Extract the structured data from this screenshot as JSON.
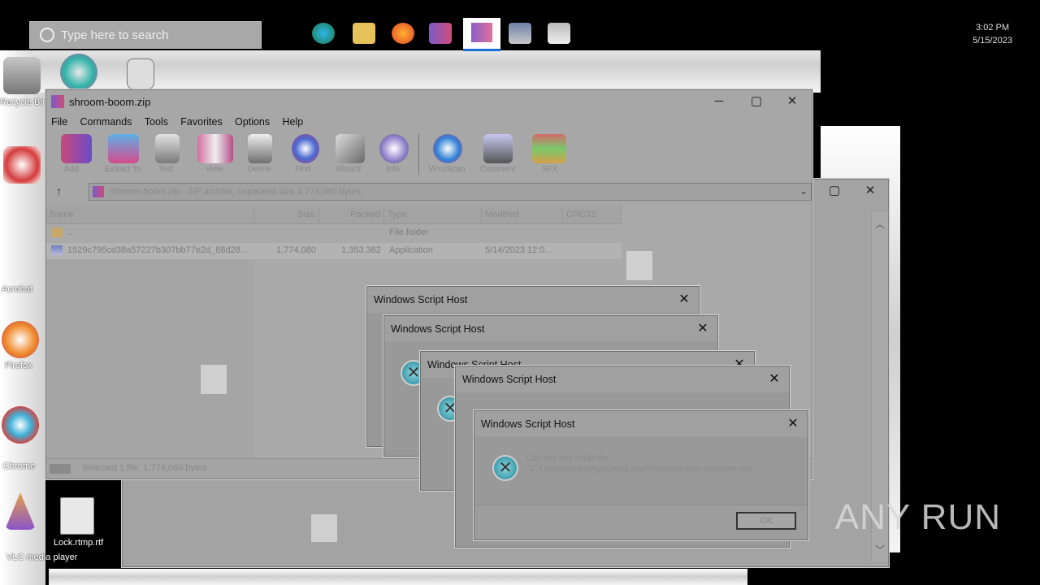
{
  "taskbar": {
    "search_placeholder": "Type here to search",
    "clock_time": "3:02 PM",
    "clock_date": "5/15/2023"
  },
  "desktop": {
    "icons": [
      "Recycle Bin",
      "Acrobat",
      "Firefox",
      "Chrome",
      "VLC media player",
      "Lock.rtmp.rtf"
    ]
  },
  "main_window": {
    "title": "shroom-boom.zip",
    "menu": [
      "File",
      "Commands",
      "Tools",
      "Favorites",
      "Options",
      "Help"
    ],
    "toolbar": [
      "Add",
      "Extract To",
      "Test",
      "View",
      "Delete",
      "Find",
      "Wizard",
      "Info",
      "VirusScan",
      "Comment",
      "SFX"
    ],
    "address": "shroom-boom.zip - ZIP archive, unpacked size 1,774,080 bytes",
    "columns": [
      "Name",
      "Size",
      "Packed",
      "Type",
      "Modified",
      "CRC32"
    ],
    "rows": [
      {
        "name": "..",
        "size": "",
        "packed": "",
        "type": "File folder",
        "modified": "",
        "crc": ""
      },
      {
        "name": "1529c795cd38a57227b307bb77e2d_88d28...",
        "size": "1,774,080",
        "packed": "1,353,362",
        "type": "Application",
        "modified": "5/14/2023 12:0...",
        "crc": ""
      }
    ],
    "status": "Selected 1 file, 1,774,080 bytes"
  },
  "dialogs": [
    {
      "title": "Windows Script Host"
    },
    {
      "title": "Windows Script Host"
    },
    {
      "title": "Windows Script Host"
    },
    {
      "title": "Windows Script Host"
    },
    {
      "title": "Windows Script Host",
      "message_line1": "Can not find script file",
      "message_line2": "\"C:\\Users\\admin\\AppData\\Local\\Temp\\shroom-boom\\eb.vbs\".",
      "ok": "OK"
    }
  ],
  "watermark": "ANY RUN"
}
